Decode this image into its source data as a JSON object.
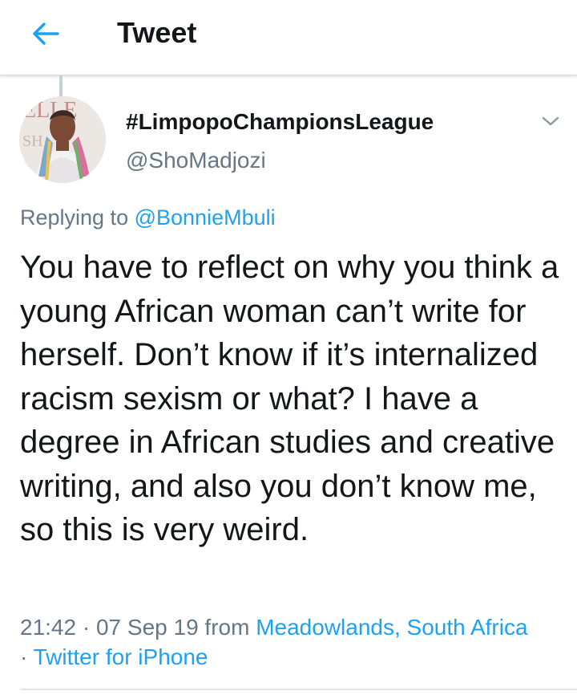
{
  "colors": {
    "accent": "#1da1f2",
    "text": "#14171a",
    "secondary": "#657786"
  },
  "header": {
    "back_icon": "arrow-left-icon",
    "title": "Tweet"
  },
  "tweet": {
    "display_name": "#LimpopoChampionsLeague",
    "handle": "@ShoMadjozi",
    "menu_icon": "chevron-down-icon",
    "replying_prefix": "Replying to",
    "replying_to": "@BonnieMbuli",
    "text": "You have to reflect on why you think a young African woman can’t write for herself. Don’t know if it’s internalized racism sexism or what? I have a degree in African studies and creative writing, and also you don’t know me, so this is very weird.",
    "time": "21:42",
    "separator": "·",
    "date": "07 Sep 19",
    "from_word": "from",
    "location": "Meadowlands, South Africa",
    "client": "Twitter for iPhone"
  }
}
